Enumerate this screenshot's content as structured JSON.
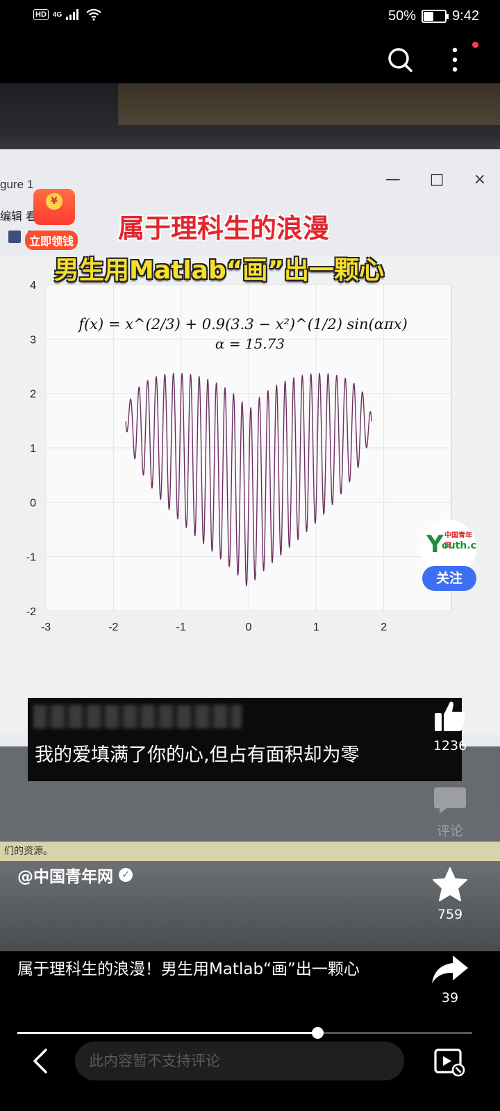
{
  "status_bar": {
    "network_label": "HD",
    "signal_label": "4G",
    "battery_percent": "50%",
    "battery_level": 0.5,
    "time": "9:42"
  },
  "top_actions": {
    "search_icon": "search-icon",
    "more_icon": "more-vertical-icon"
  },
  "video": {
    "window": {
      "title": "gure 1",
      "menu": "编辑  看(V)",
      "controls": [
        "—",
        "□",
        "×"
      ]
    },
    "overlay_title": {
      "line1": "属于理科生的浪漫",
      "line2": "男生用Matlab“画”出一颗心",
      "line1_color": "#e3262d",
      "line2_color": "#f7de2a"
    },
    "red_packet": {
      "coin": "¥",
      "label": "立即领钱"
    },
    "status_strip_text": "们的资源。",
    "subtitle_text": "我的爱填满了你的心,但占有面积却为零"
  },
  "chart_data": {
    "type": "line",
    "title": "f(x) = x^(2/3) + 0.9(3.3 − x²)^(1/2) sin(απx)",
    "subtitle": "α = 15.73",
    "xlabel": "",
    "ylabel": "",
    "xlim": [
      -3,
      3
    ],
    "ylim": [
      -2,
      4
    ],
    "xticks": [
      "-3",
      "-2",
      "-1",
      "0",
      "1",
      "2"
    ],
    "yticks": [
      "4",
      "3",
      "2",
      "1",
      "0",
      "-1",
      "-2"
    ],
    "grid": true,
    "function": {
      "exponent": 0.6667,
      "amplitude": 0.9,
      "c": 3.3,
      "alpha": 15.73
    },
    "x_domain": [
      -1.8166,
      1.8166
    ],
    "line_color": "#6b2f63"
  },
  "right_rail": {
    "avatar_text": "中国青年网 outh.cn",
    "follow_label": "关注",
    "like_count": "1236",
    "comment_label": "评论",
    "favorite_count": "759",
    "share_count": "39"
  },
  "caption": {
    "author": "@中国青年网",
    "text": "属于理科生的浪漫！男生用Matlab“画”出一颗心"
  },
  "playback": {
    "progress": 0.66
  },
  "bottom_bar": {
    "comment_placeholder": "此内容暂不支持评论"
  }
}
